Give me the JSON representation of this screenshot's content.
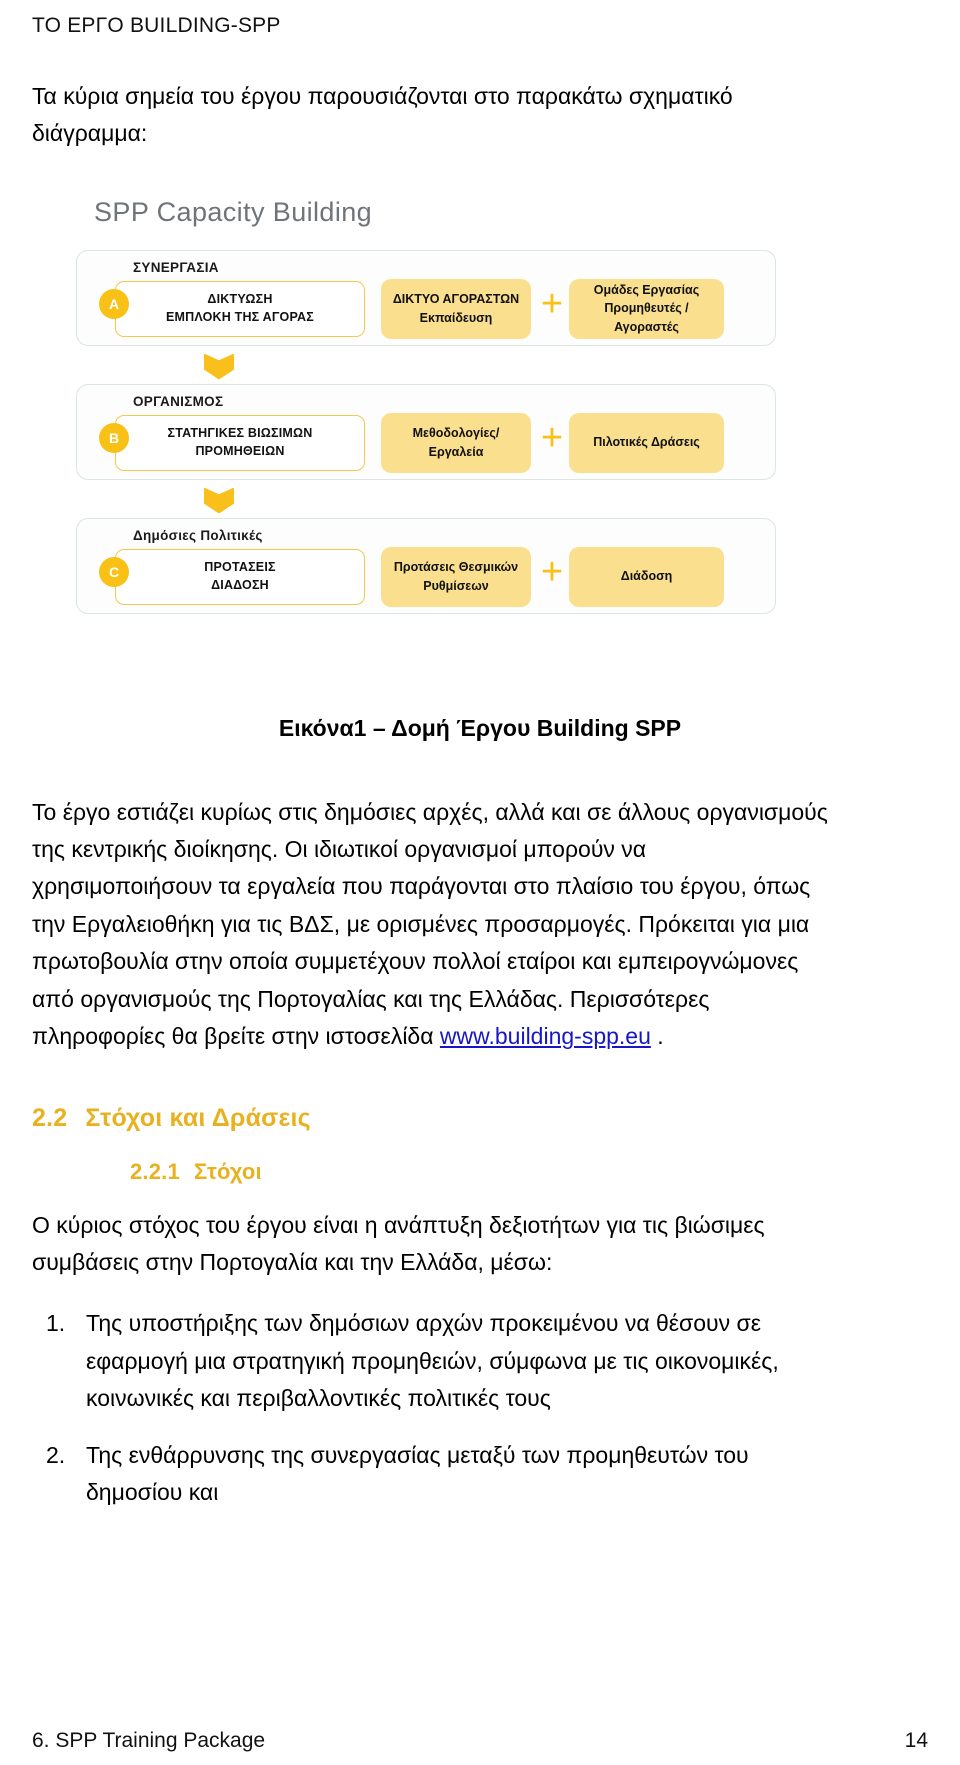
{
  "header": {
    "running_title": "ΤΟ ΕΡΓΟ BUILDING-SPP"
  },
  "intro": {
    "line1": "Τα κύρια σημεία του έργου παρουσιάζονται στο παρακάτω σχηματικό",
    "line2": "διάγραμμα:"
  },
  "figure": {
    "title": "SPP Capacity Building",
    "caption": "Εικόνα1 – Δομή Έργου Building SPP",
    "plus_symbol": "+",
    "rows": [
      {
        "badge": "A",
        "band_label": "ΣΥΝΕΡΓΑΣΙΑ",
        "left_line1": "ΔΙΚΤΥΩΣΗ",
        "left_line2": "ΕΜΠΛΟΚΗ ΤΗΣ ΑΓΟΡΑΣ",
        "mid_line1": "ΔΙΚΤΥΟ ΑΓΟΡΑΣΤΩΝ",
        "mid_line2": "Εκπαίδευση",
        "right_line1": "Ομάδες Εργασίας",
        "right_line2": "Προμηθευτές /",
        "right_line3": "Αγοραστές"
      },
      {
        "badge": "B",
        "band_label": "ΟΡΓΑΝΙΣΜΟΣ",
        "left_line1": "ΣΤΑΤΗΓΙΚΕΣ ΒΙΩΣΙΜΩΝ",
        "left_line2": "ΠΡΟΜΗΘΕΙΩΝ",
        "mid_line1": "Μεθοδολογίες/Εργαλεία",
        "mid_line2": "",
        "right_line1": "Πιλοτικές Δράσεις",
        "right_line2": "",
        "right_line3": ""
      },
      {
        "badge": "C",
        "band_label": "Δημόσιες Πολιτικές",
        "left_line1": "ΠΡΟΤΑΣΕΙΣ",
        "left_line2": "ΔΙΑΔΟΣΗ",
        "mid_line1": "Προτάσεις Θεσμικών",
        "mid_line2": "Ρυθμίσεων",
        "right_line1": "Διάδοση",
        "right_line2": "",
        "right_line3": ""
      }
    ]
  },
  "body": {
    "p1_line1": "Το έργο εστιάζει κυρίως στις δημόσιες αρχές, αλλά και σε άλλους οργανισμούς",
    "p1_line2": "της κεντρικής διοίκησης. Οι ιδιωτικοί οργανισμοί μπορούν να",
    "p1_line3": "χρησιμοποιήσουν τα εργαλεία που παράγονται στο πλαίσιο του έργου, όπως",
    "p1_line4": "την Εργαλειοθήκη για τις ΒΔΣ, με ορισμένες προσαρμογές. Πρόκειται για μια",
    "p1_line5": "πρωτοβουλία στην οποία συμμετέχουν πολλοί εταίροι και εμπειρογνώμονες",
    "p1_line6": "από οργανισμούς της Πορτογαλίας και της Ελλάδας. Περισσότερες",
    "p1_line7_pre": "πληροφορίες θα βρείτε στην  ιστοσελίδα ",
    "p1_link": "www.building-spp.eu",
    "p1_line7_post": " ."
  },
  "sections": {
    "s22_num": "2.2",
    "s22_title": "Στόχοι και Δράσεις",
    "s221_num": "2.2.1",
    "s221_title": "Στόχοι"
  },
  "goals": {
    "intro_line1": "Ο κύριος στόχος του έργου είναι η ανάπτυξη δεξιοτήτων για τις βιώσιμες",
    "intro_line2": "συμβάσεις στην Πορτογαλία και την Ελλάδα, μέσω:",
    "items": [
      {
        "marker": "1.",
        "line1": "Της υποστήριξης των δημόσιων αρχών προκειμένου να θέσουν σε",
        "line2": "εφαρμογή μια στρατηγική προμηθειών, σύμφωνα με τις οικονομικές,",
        "line3": "κοινωνικές και περιβαλλοντικές πολιτικές τους"
      },
      {
        "marker": "2.",
        "line1": "Της ενθάρρυνσης της συνεργασίας μεταξύ των προμηθευτών του",
        "line2": "δημοσίου και",
        "line3": ""
      }
    ]
  },
  "footer": {
    "left": "6. SPP Training Package",
    "page_number": "14"
  }
}
